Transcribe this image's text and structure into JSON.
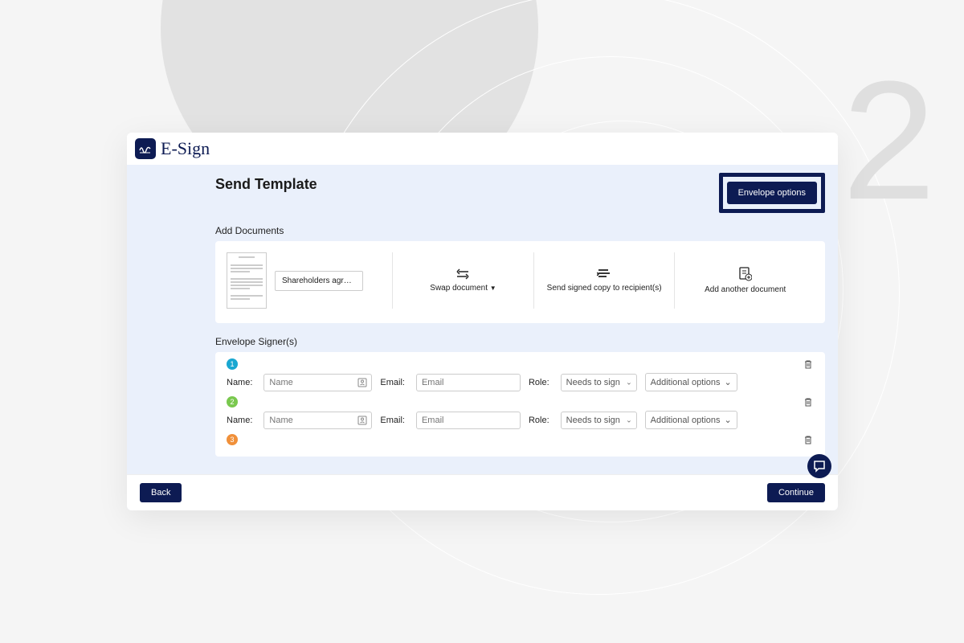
{
  "step_number": "2",
  "logo_text": "E-Sign",
  "page_title": "Send Template",
  "envelope_options_label": "Envelope options",
  "add_documents": {
    "section_label": "Add Documents",
    "document_name": "Shareholders agreemer",
    "swap_label": "Swap document",
    "send_copy_label": "Send signed copy to recipient(s)",
    "add_another_label": "Add another document"
  },
  "signers": {
    "section_label": "Envelope Signer(s)",
    "name_label": "Name:",
    "email_label": "Email:",
    "role_label": "Role:",
    "name_placeholder": "Name",
    "email_placeholder": "Email",
    "role_value": "Needs to sign",
    "additional_options": "Additional options",
    "rows": [
      "1",
      "2",
      "3"
    ]
  },
  "footer": {
    "back": "Back",
    "continue": "Continue"
  }
}
